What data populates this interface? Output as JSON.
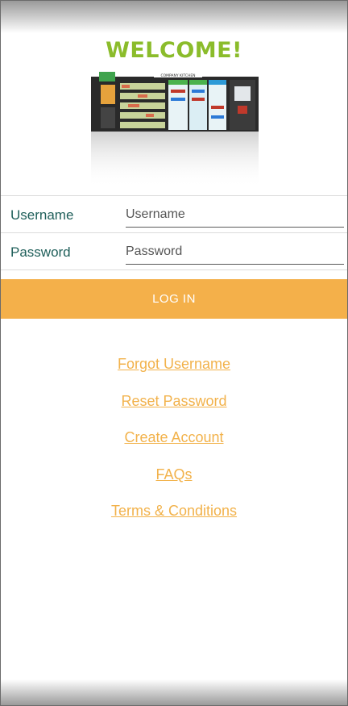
{
  "header": {
    "welcome": "WELCOME!"
  },
  "hero": {
    "logo_text": "COMPANY KITCHEN"
  },
  "form": {
    "username_label": "Username",
    "username_placeholder": "Username",
    "password_label": "Password",
    "password_placeholder": "Password",
    "login_label": "LOG IN"
  },
  "links": {
    "forgot_username": "Forgot Username",
    "reset_password": "Reset Password",
    "create_account": "Create Account",
    "faqs": "FAQs",
    "terms": "Terms & Conditions"
  },
  "colors": {
    "accent": "#f4b04a",
    "welcome_green": "#8bbc2b",
    "label_teal": "#1f5f5a"
  }
}
